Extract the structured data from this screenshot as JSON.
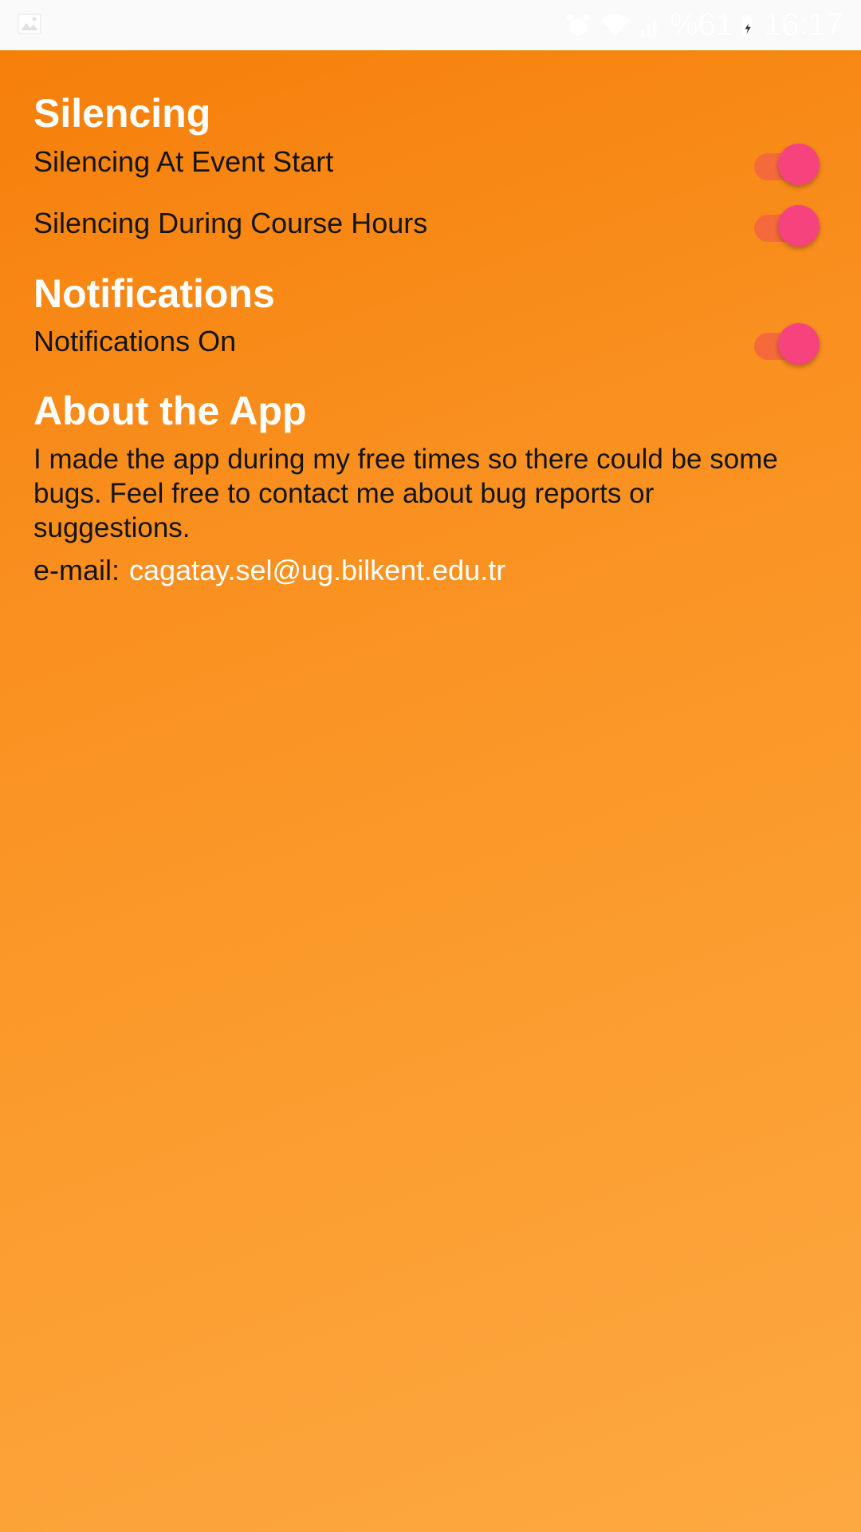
{
  "status_bar": {
    "battery_text": "%61",
    "clock": "16:17",
    "icons": [
      "gallery-icon",
      "alarm-icon",
      "wifi-icon",
      "signal-icon",
      "battery-icon"
    ]
  },
  "silencing": {
    "title": "Silencing",
    "items": [
      {
        "label": "Silencing At Event Start",
        "enabled": true
      },
      {
        "label": "Silencing During Course Hours",
        "enabled": true
      }
    ]
  },
  "notifications": {
    "title": "Notifications",
    "items": [
      {
        "label": "Notifications On",
        "enabled": true
      }
    ]
  },
  "about": {
    "title": "About the App",
    "body": "I made the app during my free times so there could be some bugs. Feel free to contact me about bug reports or suggestions.",
    "email_label": "e-mail:",
    "email": "cagatay.sel@ug.bilkent.edu.tr"
  },
  "colors": {
    "background_start": "#f67f0a",
    "background_end": "#fda941",
    "toggle_thumb": "#f6437e",
    "toggle_track": "#f56a3a",
    "heading_text": "#ffffff",
    "body_text": "#141414"
  }
}
